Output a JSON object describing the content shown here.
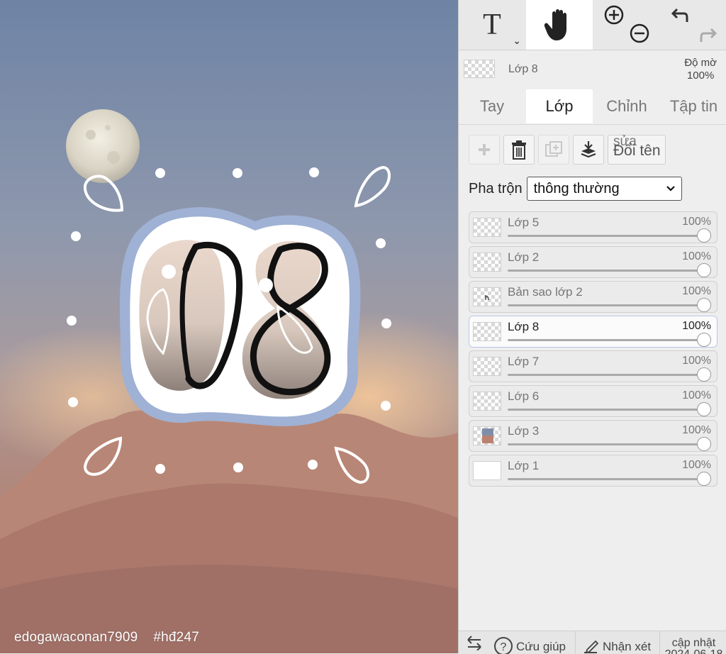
{
  "canvas": {
    "sticker_number": "08",
    "watermark": {
      "user": "edogawaconan7909",
      "tag": "#hđ247"
    }
  },
  "toolbar": {
    "text_tool": "T",
    "text_tool_caret": "⌄",
    "hand_tool_icon": "hand-icon",
    "zoom_icons": [
      "zoom-in-icon",
      "zoom-out-icon"
    ],
    "undo_icons": [
      "undo-icon",
      "redo-icon"
    ]
  },
  "current_layer": {
    "name": "Lớp 8",
    "opacity_label": "Độ mờ",
    "opacity_value": "100%"
  },
  "tabs": [
    {
      "label": "Tay",
      "active": false
    },
    {
      "label": "Lớp",
      "active": true
    },
    {
      "label": "Chỉnh",
      "active": false
    },
    {
      "label": "Tập tin",
      "active": false
    }
  ],
  "layer_panel": {
    "rename_top": "sửa",
    "rename_label": "Đổi tên",
    "blend_label": "Pha trộn",
    "blend_value": "thông thường",
    "layers": [
      {
        "name": "Lớp 5",
        "opacity": "100%",
        "selected": false
      },
      {
        "name": "Lớp 2",
        "opacity": "100%",
        "selected": false
      },
      {
        "name": "Bản sao lớp 2",
        "opacity": "100%",
        "selected": false
      },
      {
        "name": "Lớp 8",
        "opacity": "100%",
        "selected": true
      },
      {
        "name": "Lớp 7",
        "opacity": "100%",
        "selected": false
      },
      {
        "name": "Lớp 6",
        "opacity": "100%",
        "selected": false
      },
      {
        "name": "Lớp 3",
        "opacity": "100%",
        "selected": false
      },
      {
        "name": "Lớp 1",
        "opacity": "100%",
        "selected": false
      }
    ]
  },
  "bottom_bar": {
    "help": "Cứu giúp",
    "comment": "Nhận xét",
    "update": "cập nhật",
    "update_date": "2024-06-18"
  }
}
